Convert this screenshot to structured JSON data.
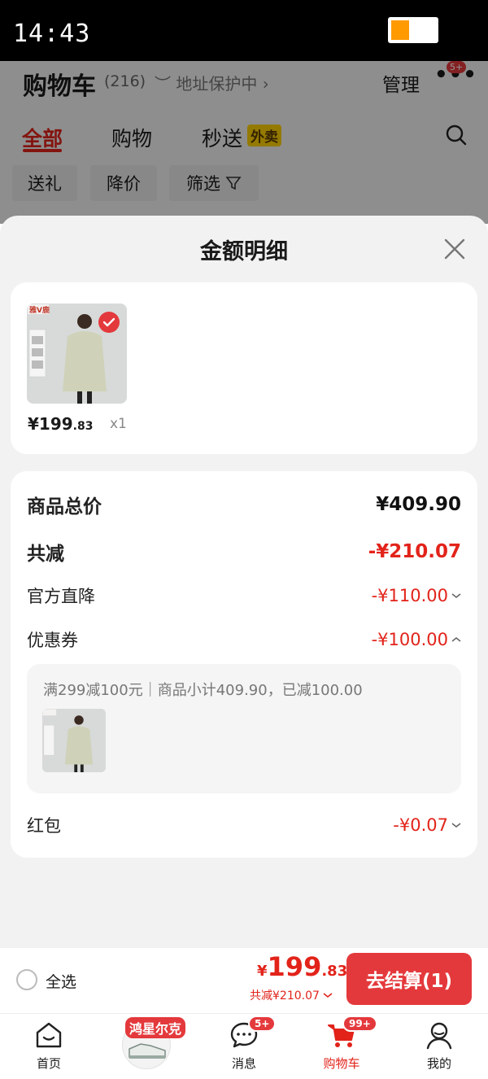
{
  "status_bar": {
    "time": "14:43"
  },
  "background": {
    "title": "购物车",
    "count": "(216)",
    "address_label": "地址保护中",
    "manage_label": "管理",
    "more_badge": "5+",
    "tabs": [
      {
        "label": "全部"
      },
      {
        "label": "购物"
      },
      {
        "label": "秒送"
      }
    ],
    "waimai_tag": "外卖",
    "filters": [
      {
        "label": "送礼"
      },
      {
        "label": "降价"
      },
      {
        "label": "筛选"
      }
    ]
  },
  "sheet": {
    "title": "金额明细",
    "product": {
      "brand_logo": "雅鹿",
      "price_int": "¥199",
      "price_dec": ".83",
      "qty": "x1"
    },
    "rows": {
      "total_label": "商品总价",
      "total_value": "¥409.90",
      "discount_label": "共减",
      "discount_value": "-¥210.07",
      "official_label": "官方直降",
      "official_value": "-¥110.00",
      "coupon_label": "优惠券",
      "coupon_value": "-¥100.00",
      "coupon_detail": "满299减100元｜商品小计409.90，已减100.00",
      "redpacket_label": "红包",
      "redpacket_value": "-¥0.07"
    }
  },
  "checkout": {
    "select_all": "全选",
    "yen": "¥",
    "total_int": "199",
    "total_dec": ".83",
    "saved": "共减¥210.07",
    "pay_button": "去结算(1)"
  },
  "nav": {
    "items": [
      {
        "label": "首页"
      },
      {
        "label": "消息",
        "badge": "5+"
      },
      {
        "label": "购物车",
        "badge": "99+"
      },
      {
        "label": "我的"
      }
    ],
    "promo_tag": "鸿星尔克"
  },
  "colors": {
    "accent": "#e2231a",
    "button": "#e4393c",
    "sheet_bg": "#f2f2f2"
  }
}
